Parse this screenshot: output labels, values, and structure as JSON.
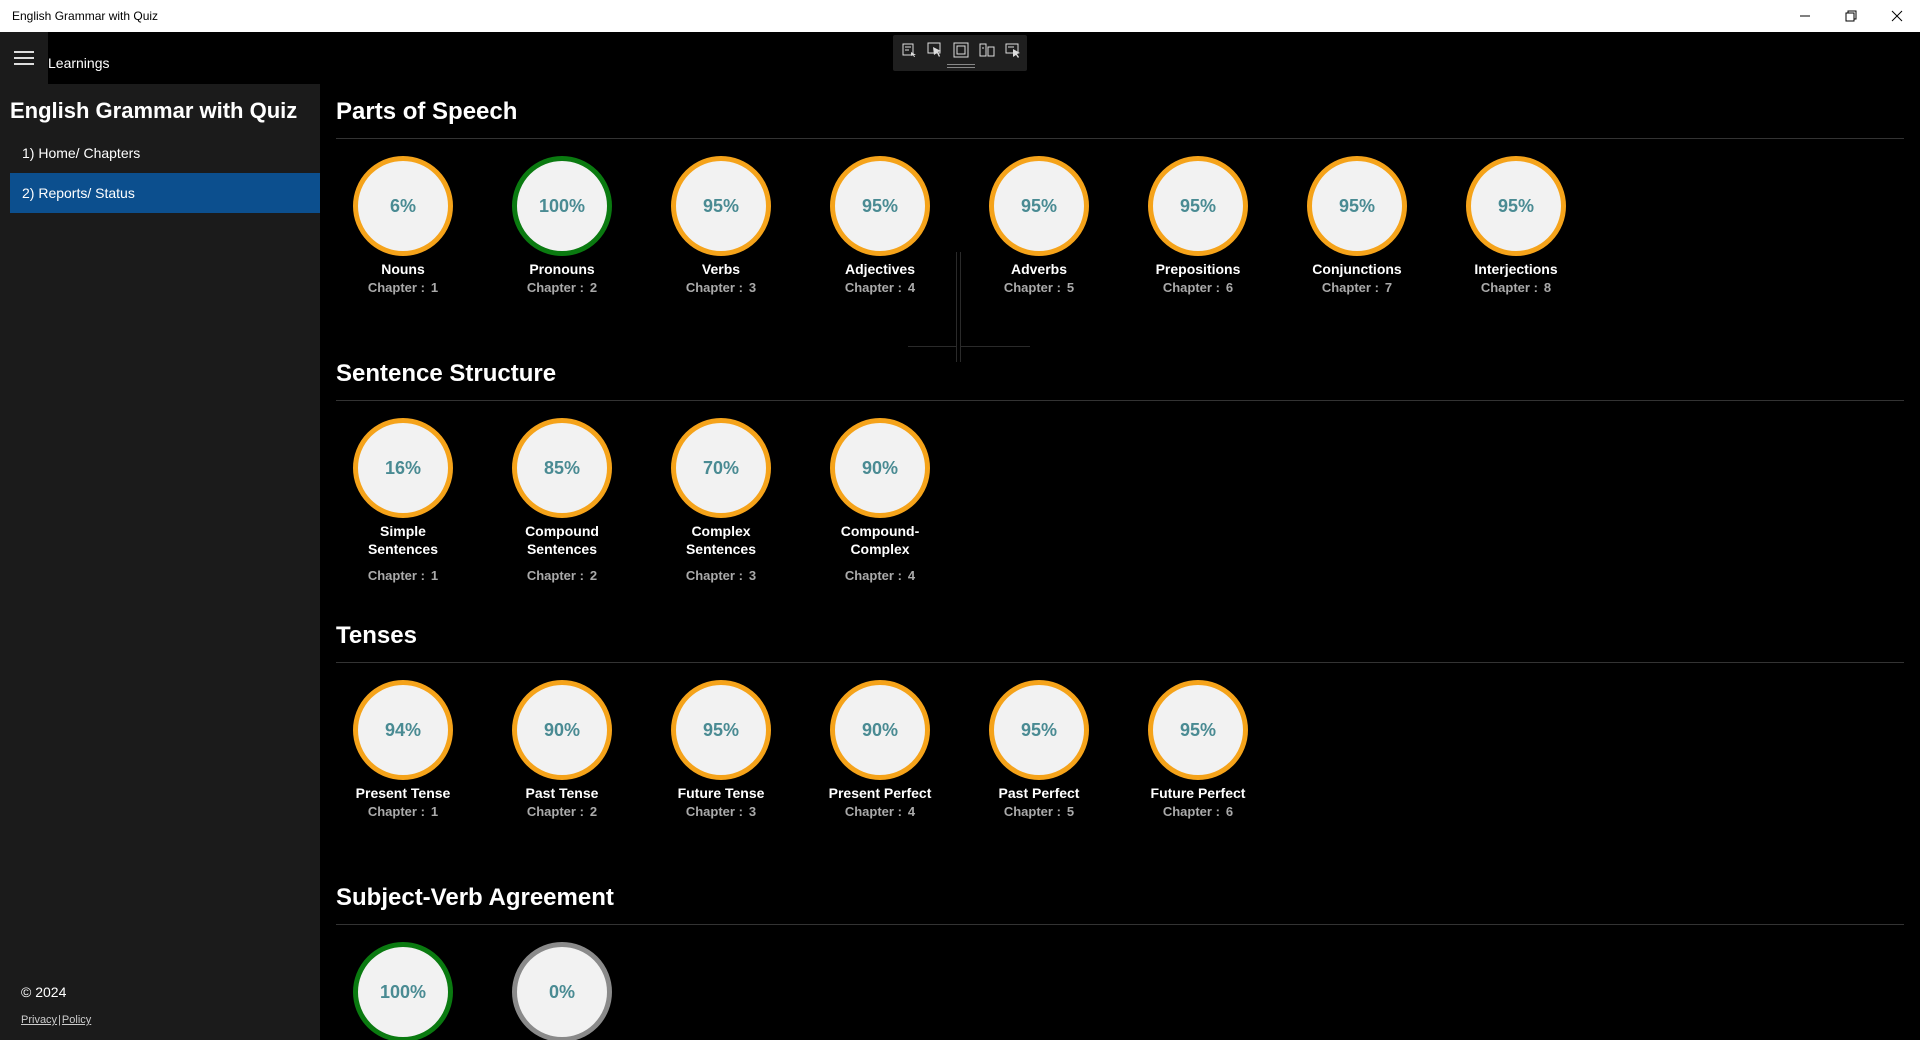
{
  "window": {
    "title": "English Grammar with Quiz"
  },
  "header": {
    "title": "Learnings"
  },
  "sidebar": {
    "title": "English Grammar with Quiz",
    "items": [
      {
        "label": "1) Home/ Chapters",
        "active": false
      },
      {
        "label": "2) Reports/ Status",
        "active": true
      }
    ],
    "copyright": "© 2024",
    "links": [
      "Privacy",
      "Policy"
    ]
  },
  "chapter_prefix": "Chapter :",
  "colors": {
    "accent_active": "#0c4f8e",
    "ring_orange": "#f5a31a",
    "ring_green": "#0a7a10",
    "ring_gray": "#8a8a8a",
    "percent_text": "#4a8b93"
  },
  "sections": [
    {
      "title": "Parts of Speech",
      "items": [
        {
          "percent": "6%",
          "name": "Nouns",
          "chapter": "1",
          "ring": "orange"
        },
        {
          "percent": "100%",
          "name": "Pronouns",
          "chapter": "2",
          "ring": "green"
        },
        {
          "percent": "95%",
          "name": "Verbs",
          "chapter": "3",
          "ring": "orange"
        },
        {
          "percent": "95%",
          "name": "Adjectives",
          "chapter": "4",
          "ring": "orange"
        },
        {
          "percent": "95%",
          "name": "Adverbs",
          "chapter": "5",
          "ring": "orange"
        },
        {
          "percent": "95%",
          "name": "Prepositions",
          "chapter": "6",
          "ring": "orange"
        },
        {
          "percent": "95%",
          "name": "Conjunctions",
          "chapter": "7",
          "ring": "orange"
        },
        {
          "percent": "95%",
          "name": "Interjections",
          "chapter": "8",
          "ring": "orange"
        }
      ]
    },
    {
      "title": "Sentence Structure",
      "items": [
        {
          "percent": "16%",
          "name": "Simple Sentences",
          "chapter": "1",
          "ring": "orange"
        },
        {
          "percent": "85%",
          "name": "Compound Sentences",
          "chapter": "2",
          "ring": "orange"
        },
        {
          "percent": "70%",
          "name": "Complex Sentences",
          "chapter": "3",
          "ring": "orange"
        },
        {
          "percent": "90%",
          "name": "Compound-Complex",
          "chapter": "4",
          "ring": "orange"
        }
      ]
    },
    {
      "title": "Tenses",
      "items": [
        {
          "percent": "94%",
          "name": "Present Tense",
          "chapter": "1",
          "ring": "orange"
        },
        {
          "percent": "90%",
          "name": "Past Tense",
          "chapter": "2",
          "ring": "orange"
        },
        {
          "percent": "95%",
          "name": "Future Tense",
          "chapter": "3",
          "ring": "orange"
        },
        {
          "percent": "90%",
          "name": "Present Perfect",
          "chapter": "4",
          "ring": "orange"
        },
        {
          "percent": "95%",
          "name": "Past Perfect",
          "chapter": "5",
          "ring": "orange"
        },
        {
          "percent": "95%",
          "name": "Future Perfect",
          "chapter": "6",
          "ring": "orange"
        }
      ]
    },
    {
      "title": "Subject-Verb Agreement",
      "items": [
        {
          "percent": "100%",
          "name": "",
          "chapter": "",
          "ring": "green"
        },
        {
          "percent": "0%",
          "name": "",
          "chapter": "",
          "ring": "gray"
        }
      ]
    }
  ]
}
